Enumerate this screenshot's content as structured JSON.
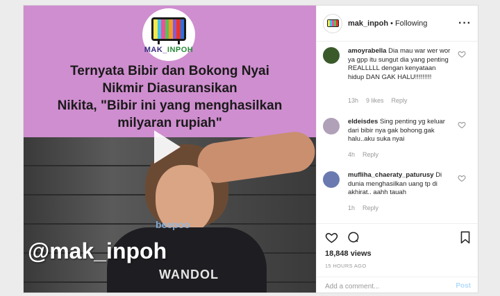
{
  "media": {
    "logo_text_a": "MAK_",
    "logo_text_b": "INPOH",
    "headline_lines": [
      "Ternyata Bibir dan Bokong Nyai",
      "Nikmir Diasuransikan",
      "Nikita, \"Bibir ini yang menghasilkan",
      "milyaran rupiah\""
    ],
    "watermark": "beepoo",
    "handle": "@mak_inpoh",
    "shirt_text": "WANDOL",
    "colors": {
      "banner": "#cf8ecf",
      "tv_bars": [
        "#f5e84a",
        "#3ec5ee",
        "#f04f9a",
        "#59c15a",
        "#f39a2b",
        "#8a5ad2",
        "#e8362e",
        "#2e6fe0"
      ]
    }
  },
  "header": {
    "username": "mak_inpoh",
    "separator": "•",
    "follow_status": "Following",
    "more_icon": "more-horizontal-icon"
  },
  "comments": [
    {
      "username": "amoyrabella",
      "text": "Dia mau war wer wor ya gpp itu sungut dia yang penting REALLLLL dengan kenyataan hidup DAN GAK HALU!!!!!!!!!",
      "time": "13h",
      "likes": "9 likes",
      "reply": "Reply",
      "avatar_color": "#3a5a2a"
    },
    {
      "username": "eldeisdes",
      "text": "Sing penting yg keluar dari bibir nya gak bohong.gak halu..aku suka nyai",
      "time": "4h",
      "likes": "",
      "reply": "Reply",
      "avatar_color": "#b0a0b8"
    },
    {
      "username": "mufliha_chaeraty_paturusy",
      "text": "Di dunia menghasilkan uang tp di akhirat.. aahh tauah",
      "time": "1h",
      "likes": "",
      "reply": "Reply",
      "avatar_color": "#6a7ab0"
    }
  ],
  "actions": {
    "like_icon": "heart-icon",
    "comment_icon": "comment-icon",
    "bookmark_icon": "bookmark-icon",
    "views": "18,848 views",
    "time_ago": "15 HOURS AGO",
    "comment_placeholder": "Add a comment...",
    "post_label": "Post"
  }
}
